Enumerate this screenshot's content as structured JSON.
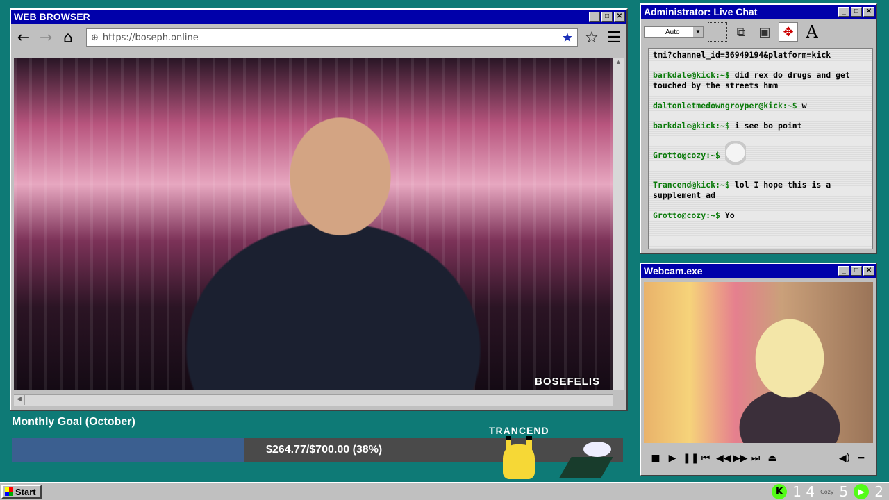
{
  "browser": {
    "title": "WEB BROWSER",
    "url": "https://boseph.online",
    "watermark": "BOSEFELIS",
    "icons": [
      "back-arrow-icon",
      "forward-arrow-icon",
      "home-icon",
      "globe-icon",
      "bookmark-star-filled-icon",
      "bookmark-star-outline-icon",
      "menu-icon"
    ]
  },
  "goal": {
    "title": "Monthly Goal (October)",
    "progress_text": "$264.77/$700.00 (38%)",
    "fraction": 0.38,
    "top_donor": "TRANCEND"
  },
  "chat": {
    "title": "Administrator: Live Chat",
    "mode": "Auto",
    "messages": [
      {
        "user": "",
        "text": "tmi?channel_id=36949194&platform=kick"
      },
      {
        "user": "barkdale@kick:~$",
        "text": "did rex do drugs and get touched by the streets hmm"
      },
      {
        "user": "daltonletmedowngroyper@kick:~$",
        "text": "w"
      },
      {
        "user": "barkdale@kick:~$",
        "text": "i see bo point"
      },
      {
        "user": "Grotto@cozy:~$",
        "text": ""
      },
      {
        "user": "Trancend@kick:~$",
        "text": "lol I hope this is a supplement ad"
      },
      {
        "user": "Grotto@cozy:~$",
        "text": "Yo"
      }
    ]
  },
  "webcam": {
    "title": "Webcam.exe"
  },
  "taskbar": {
    "start": "Start",
    "tray": {
      "kick_count": "1 4",
      "cozy_label": "Cozy",
      "cozy_count": "5",
      "play_count": "2"
    }
  },
  "colors": {
    "title_blue": "#0000aa",
    "desktop": "#0e7a76",
    "chat_user_green": "#0a7a0a",
    "goal_fill": "#3b5f90"
  }
}
